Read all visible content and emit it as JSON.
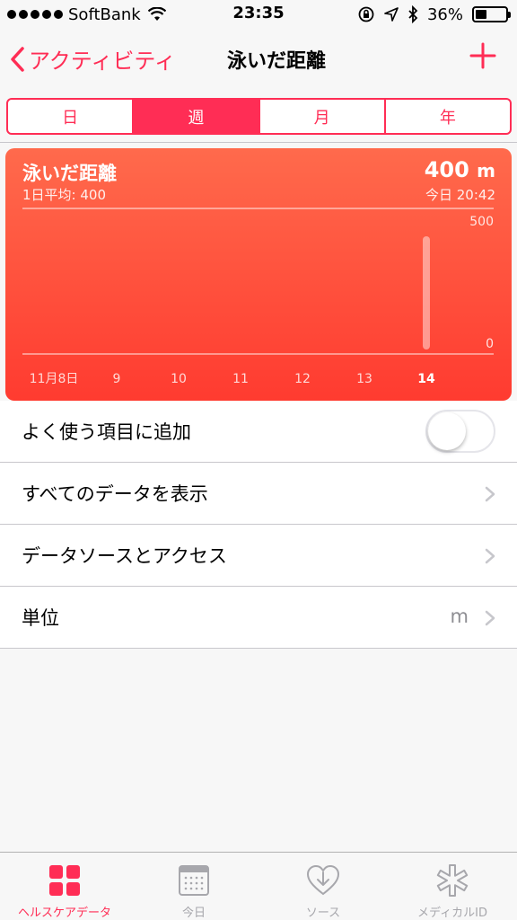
{
  "status_bar": {
    "carrier": "SoftBank",
    "time": "23:35",
    "battery": "36%",
    "battery_level": 0.36
  },
  "nav": {
    "back_label": "アクティビティ",
    "title": "泳いだ距離"
  },
  "segments": [
    {
      "label": "日",
      "active": false
    },
    {
      "label": "週",
      "active": true
    },
    {
      "label": "月",
      "active": false
    },
    {
      "label": "年",
      "active": false
    }
  ],
  "card": {
    "title": "泳いだ距離",
    "subtitle": "1日平均: 400",
    "value": "400",
    "unit": "m",
    "timestamp": "今日 20:42"
  },
  "chart_data": {
    "type": "bar",
    "categories": [
      "11月8日",
      "9",
      "10",
      "11",
      "12",
      "13",
      "14"
    ],
    "values": [
      0,
      0,
      0,
      0,
      0,
      0,
      400
    ],
    "ylim": [
      0,
      500
    ],
    "y_ticks": [
      "500",
      "0"
    ],
    "highlight_index": 6,
    "grid": false
  },
  "list": {
    "favorite_label": "よく使う項目に追加",
    "favorite_on": false,
    "show_all_label": "すべてのデータを表示",
    "sources_label": "データソースとアクセス",
    "unit_label": "単位",
    "unit_value": "m"
  },
  "tabs": [
    {
      "label": "ヘルスケアデータ",
      "icon": "grid-icon",
      "active": true
    },
    {
      "label": "今日",
      "icon": "calendar-icon",
      "active": false
    },
    {
      "label": "ソース",
      "icon": "heart-download-icon",
      "active": false
    },
    {
      "label": "メディカルID",
      "icon": "medical-star-icon",
      "active": false
    }
  ],
  "colors": {
    "accent": "#ff2d55",
    "card_top": "#ff6a4c",
    "card_bottom": "#ff3b30"
  }
}
